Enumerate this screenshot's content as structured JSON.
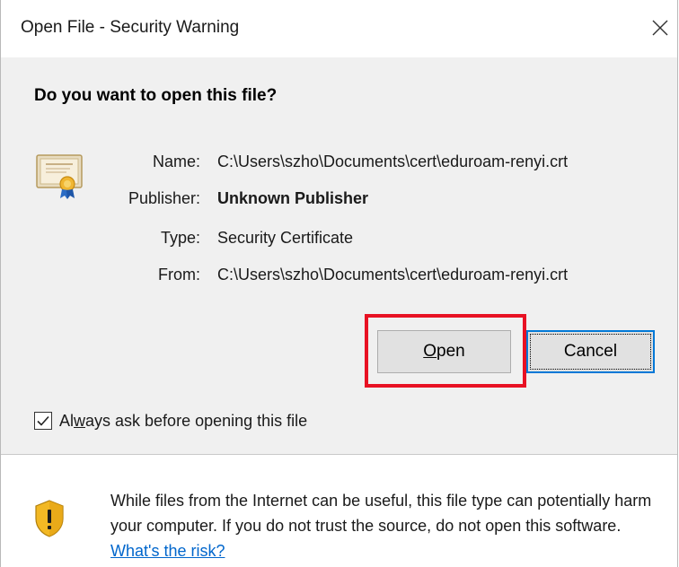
{
  "dialog": {
    "title": "Open File - Security Warning",
    "question": "Do you want to open this file?",
    "fields": [
      {
        "label": "Name:",
        "value": "C:\\Users\\szho\\Documents\\cert\\eduroam-renyi.crt"
      },
      {
        "label": "Publisher:",
        "value": "Unknown Publisher"
      },
      {
        "label": "Type:",
        "value": "Security Certificate"
      },
      {
        "label": "From:",
        "value": "C:\\Users\\szho\\Documents\\cert\\eduroam-renyi.crt"
      }
    ],
    "buttons": {
      "open_underlined": "O",
      "open_rest": "pen",
      "cancel": "Cancel"
    },
    "checkbox": {
      "label_pre": "Al",
      "label_underlined": "w",
      "label_post": "ays ask before opening this file",
      "checked": true
    },
    "warning": {
      "text": "While files from the Internet can be useful, this file type can potentially harm your computer. If you do not trust the source, do not open this software. ",
      "link": "What's the risk?"
    },
    "colors": {
      "highlight": "#e81123",
      "focus": "#0078d7",
      "link": "#0066cc"
    },
    "icons": {
      "file": "certificate-icon",
      "footer": "shield-warning-icon",
      "close": "close-icon"
    }
  }
}
